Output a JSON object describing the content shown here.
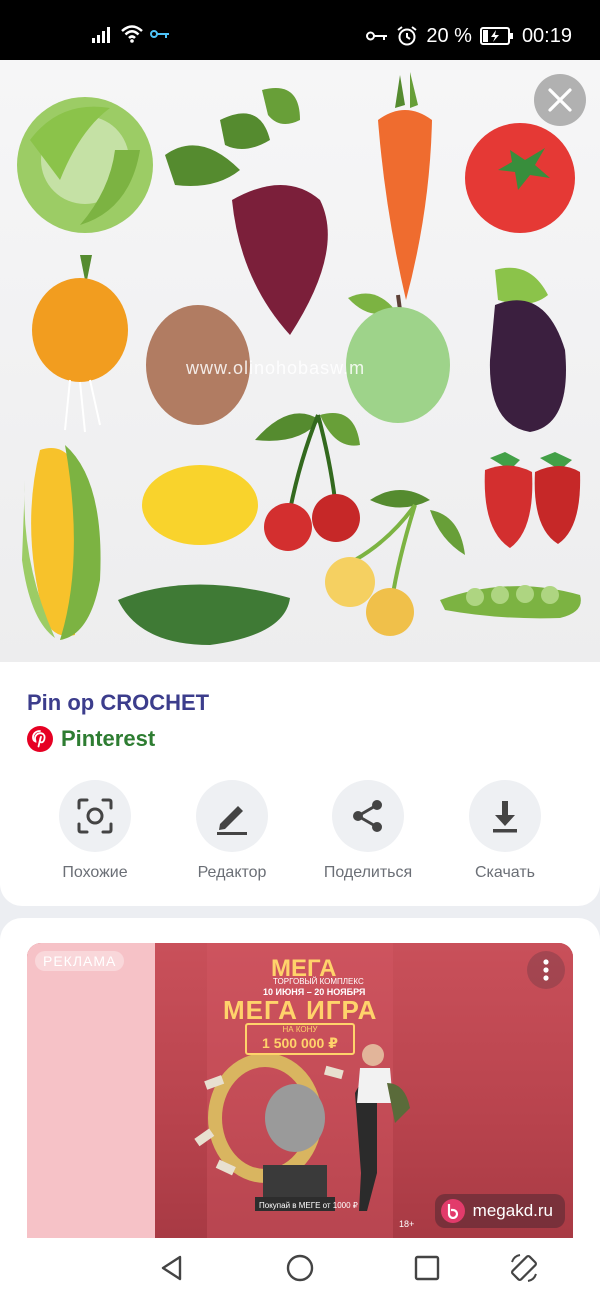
{
  "status_bar": {
    "battery": "20 %",
    "time": "00:19"
  },
  "hero": {
    "watermark": "www.olinohobasw.m"
  },
  "pin": {
    "title": "Pin op CROCHET",
    "source": "Pinterest"
  },
  "actions": [
    {
      "label": "Похожие",
      "icon": "visual-search-icon"
    },
    {
      "label": "Редактор",
      "icon": "pencil-icon"
    },
    {
      "label": "Поделиться",
      "icon": "share-icon"
    },
    {
      "label": "Скачать",
      "icon": "download-icon"
    }
  ],
  "ad": {
    "badge": "РЕКЛАМА",
    "brand": "МЕГА",
    "brand_sub": "ТОРГОВЫЙ КОМПЛЕКС",
    "dates": "10 ИЮНЯ – 20 НОЯБРЯ",
    "headline": "МЕГА ИГРА",
    "prize_label": "НА КОНУ",
    "prize": "1 500 000 ₽",
    "bottom_text": "Покупай в МЕГЕ от 1000 ₽",
    "age": "18+",
    "domain": "megakd.ru"
  },
  "colors": {
    "title": "#3c3d8c",
    "source": "#2e7d32",
    "pinterest_red": "#e60023"
  }
}
